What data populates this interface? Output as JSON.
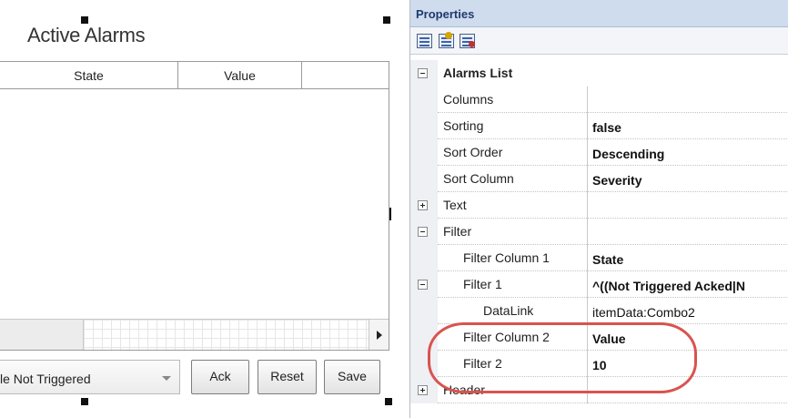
{
  "designer": {
    "title": "Active Alarms",
    "list_columns": [
      "State",
      "Value"
    ],
    "combo_value": "le Not Triggered",
    "buttons": {
      "ack": "Ack",
      "reset": "Reset",
      "save": "Save"
    }
  },
  "properties": {
    "panel_title": "Properties",
    "toolbar_icons": [
      "categorized-view-icon",
      "add-property-icon",
      "property-pages-icon"
    ],
    "rows": [
      {
        "name": "Alarms List",
        "value": "",
        "kind": "category",
        "expander": "minus"
      },
      {
        "name": "Columns",
        "value": "",
        "kind": "prop"
      },
      {
        "name": "Sorting",
        "value": "false",
        "kind": "prop"
      },
      {
        "name": "Sort Order",
        "value": "Descending",
        "kind": "prop"
      },
      {
        "name": "Sort Column",
        "value": "Severity",
        "kind": "prop"
      },
      {
        "name": "Text",
        "value": "",
        "kind": "group",
        "expander": "plus"
      },
      {
        "name": "Filter",
        "value": "",
        "kind": "group",
        "expander": "minus"
      },
      {
        "name": "Filter Column 1",
        "value": "State",
        "kind": "sub"
      },
      {
        "name": "Filter 1",
        "value": "^((Not Triggered Acked|N",
        "kind": "sub",
        "expander": "minus"
      },
      {
        "name": "DataLink",
        "value": "itemData:Combo2",
        "kind": "subsub"
      },
      {
        "name": "Filter Column 2",
        "value": "Value",
        "kind": "sub"
      },
      {
        "name": "Filter 2",
        "value": "10",
        "kind": "sub"
      },
      {
        "name": "Header",
        "value": "",
        "kind": "group",
        "expander": "plus"
      }
    ]
  },
  "colors": {
    "panel_header": "#cfdcee",
    "highlight": "#d9534f"
  }
}
